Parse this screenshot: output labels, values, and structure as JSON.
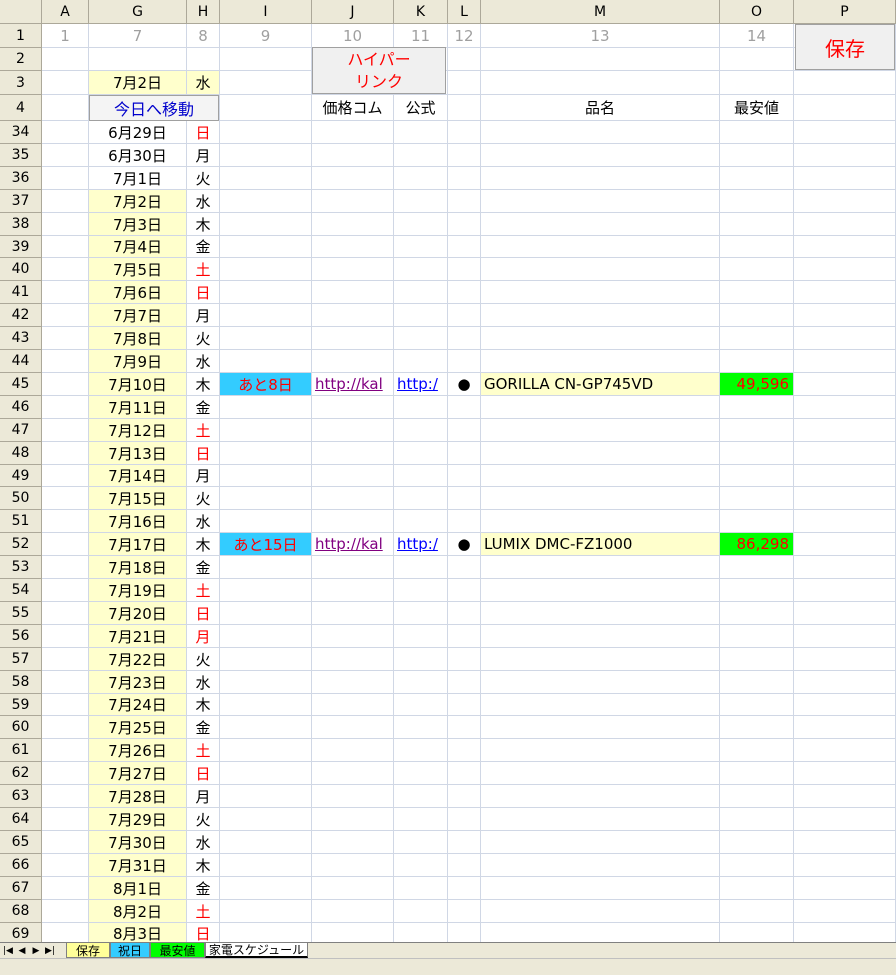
{
  "columns": [
    {
      "letter": "A",
      "num": "1"
    },
    {
      "letter": "G",
      "num": "7"
    },
    {
      "letter": "H",
      "num": "8"
    },
    {
      "letter": "I",
      "num": "9"
    },
    {
      "letter": "J",
      "num": "10"
    },
    {
      "letter": "K",
      "num": "11"
    },
    {
      "letter": "L",
      "num": "12"
    },
    {
      "letter": "M",
      "num": "13"
    },
    {
      "letter": "O",
      "num": "14"
    },
    {
      "letter": "P",
      "num": ""
    }
  ],
  "top": {
    "save_button": "保存",
    "hyperlink_button": "ハイパー\nリンク",
    "today_date": "7月2日",
    "today_weekday": "水",
    "goto_today_button": "今日へ移動",
    "rows": [
      "1",
      "2",
      "3",
      "4"
    ],
    "headers": {
      "price_com": "価格コム",
      "official": "公式",
      "product": "品名",
      "lowest": "最安値"
    }
  },
  "rows": [
    {
      "row": "34",
      "date": "6月29日",
      "day": "日",
      "red": true
    },
    {
      "row": "35",
      "date": "6月30日",
      "day": "月"
    },
    {
      "row": "36",
      "date": "7月1日",
      "day": "火"
    },
    {
      "row": "37",
      "date": "7月2日",
      "day": "水"
    },
    {
      "row": "38",
      "date": "7月3日",
      "day": "木"
    },
    {
      "row": "39",
      "date": "7月4日",
      "day": "金"
    },
    {
      "row": "40",
      "date": "7月5日",
      "day": "土",
      "red": true
    },
    {
      "row": "41",
      "date": "7月6日",
      "day": "日",
      "red": true
    },
    {
      "row": "42",
      "date": "7月7日",
      "day": "月"
    },
    {
      "row": "43",
      "date": "7月8日",
      "day": "火"
    },
    {
      "row": "44",
      "date": "7月9日",
      "day": "水"
    },
    {
      "row": "45",
      "date": "7月10日",
      "day": "木",
      "countdown": "あと8日",
      "price_link": "http://kal",
      "official_link": "http:/",
      "bullet": "●",
      "product": "GORILLA CN-GP745VD",
      "price": "49,596"
    },
    {
      "row": "46",
      "date": "7月11日",
      "day": "金"
    },
    {
      "row": "47",
      "date": "7月12日",
      "day": "土",
      "red": true
    },
    {
      "row": "48",
      "date": "7月13日",
      "day": "日",
      "red": true
    },
    {
      "row": "49",
      "date": "7月14日",
      "day": "月"
    },
    {
      "row": "50",
      "date": "7月15日",
      "day": "火"
    },
    {
      "row": "51",
      "date": "7月16日",
      "day": "水"
    },
    {
      "row": "52",
      "date": "7月17日",
      "day": "木",
      "countdown": "あと15日",
      "price_link": "http://kal",
      "official_link": "http:/",
      "bullet": "●",
      "product": "LUMIX DMC-FZ1000",
      "price": "86,298"
    },
    {
      "row": "53",
      "date": "7月18日",
      "day": "金"
    },
    {
      "row": "54",
      "date": "7月19日",
      "day": "土",
      "red": true
    },
    {
      "row": "55",
      "date": "7月20日",
      "day": "日",
      "red": true
    },
    {
      "row": "56",
      "date": "7月21日",
      "day": "月",
      "red": true
    },
    {
      "row": "57",
      "date": "7月22日",
      "day": "火"
    },
    {
      "row": "58",
      "date": "7月23日",
      "day": "水"
    },
    {
      "row": "59",
      "date": "7月24日",
      "day": "木"
    },
    {
      "row": "60",
      "date": "7月25日",
      "day": "金"
    },
    {
      "row": "61",
      "date": "7月26日",
      "day": "土",
      "red": true
    },
    {
      "row": "62",
      "date": "7月27日",
      "day": "日",
      "red": true
    },
    {
      "row": "63",
      "date": "7月28日",
      "day": "月"
    },
    {
      "row": "64",
      "date": "7月29日",
      "day": "火"
    },
    {
      "row": "65",
      "date": "7月30日",
      "day": "水"
    },
    {
      "row": "66",
      "date": "7月31日",
      "day": "木"
    },
    {
      "row": "67",
      "date": "8月1日",
      "day": "金"
    },
    {
      "row": "68",
      "date": "8月2日",
      "day": "土",
      "red": true
    },
    {
      "row": "69",
      "date": "8月3日",
      "day": "日",
      "red": true
    }
  ],
  "sheet_tabs": [
    {
      "label": "保存",
      "color": "#ffff99"
    },
    {
      "label": "祝日",
      "color": "#33ccff"
    },
    {
      "label": "最安値",
      "color": "#00ff00"
    },
    {
      "label": "家電スケジュール",
      "color": "#ffffff",
      "active": true
    }
  ],
  "colors": {
    "yellow": "#ffffcc",
    "cyan": "#33ccff",
    "green": "#00ff00",
    "red": "#ff0000"
  }
}
